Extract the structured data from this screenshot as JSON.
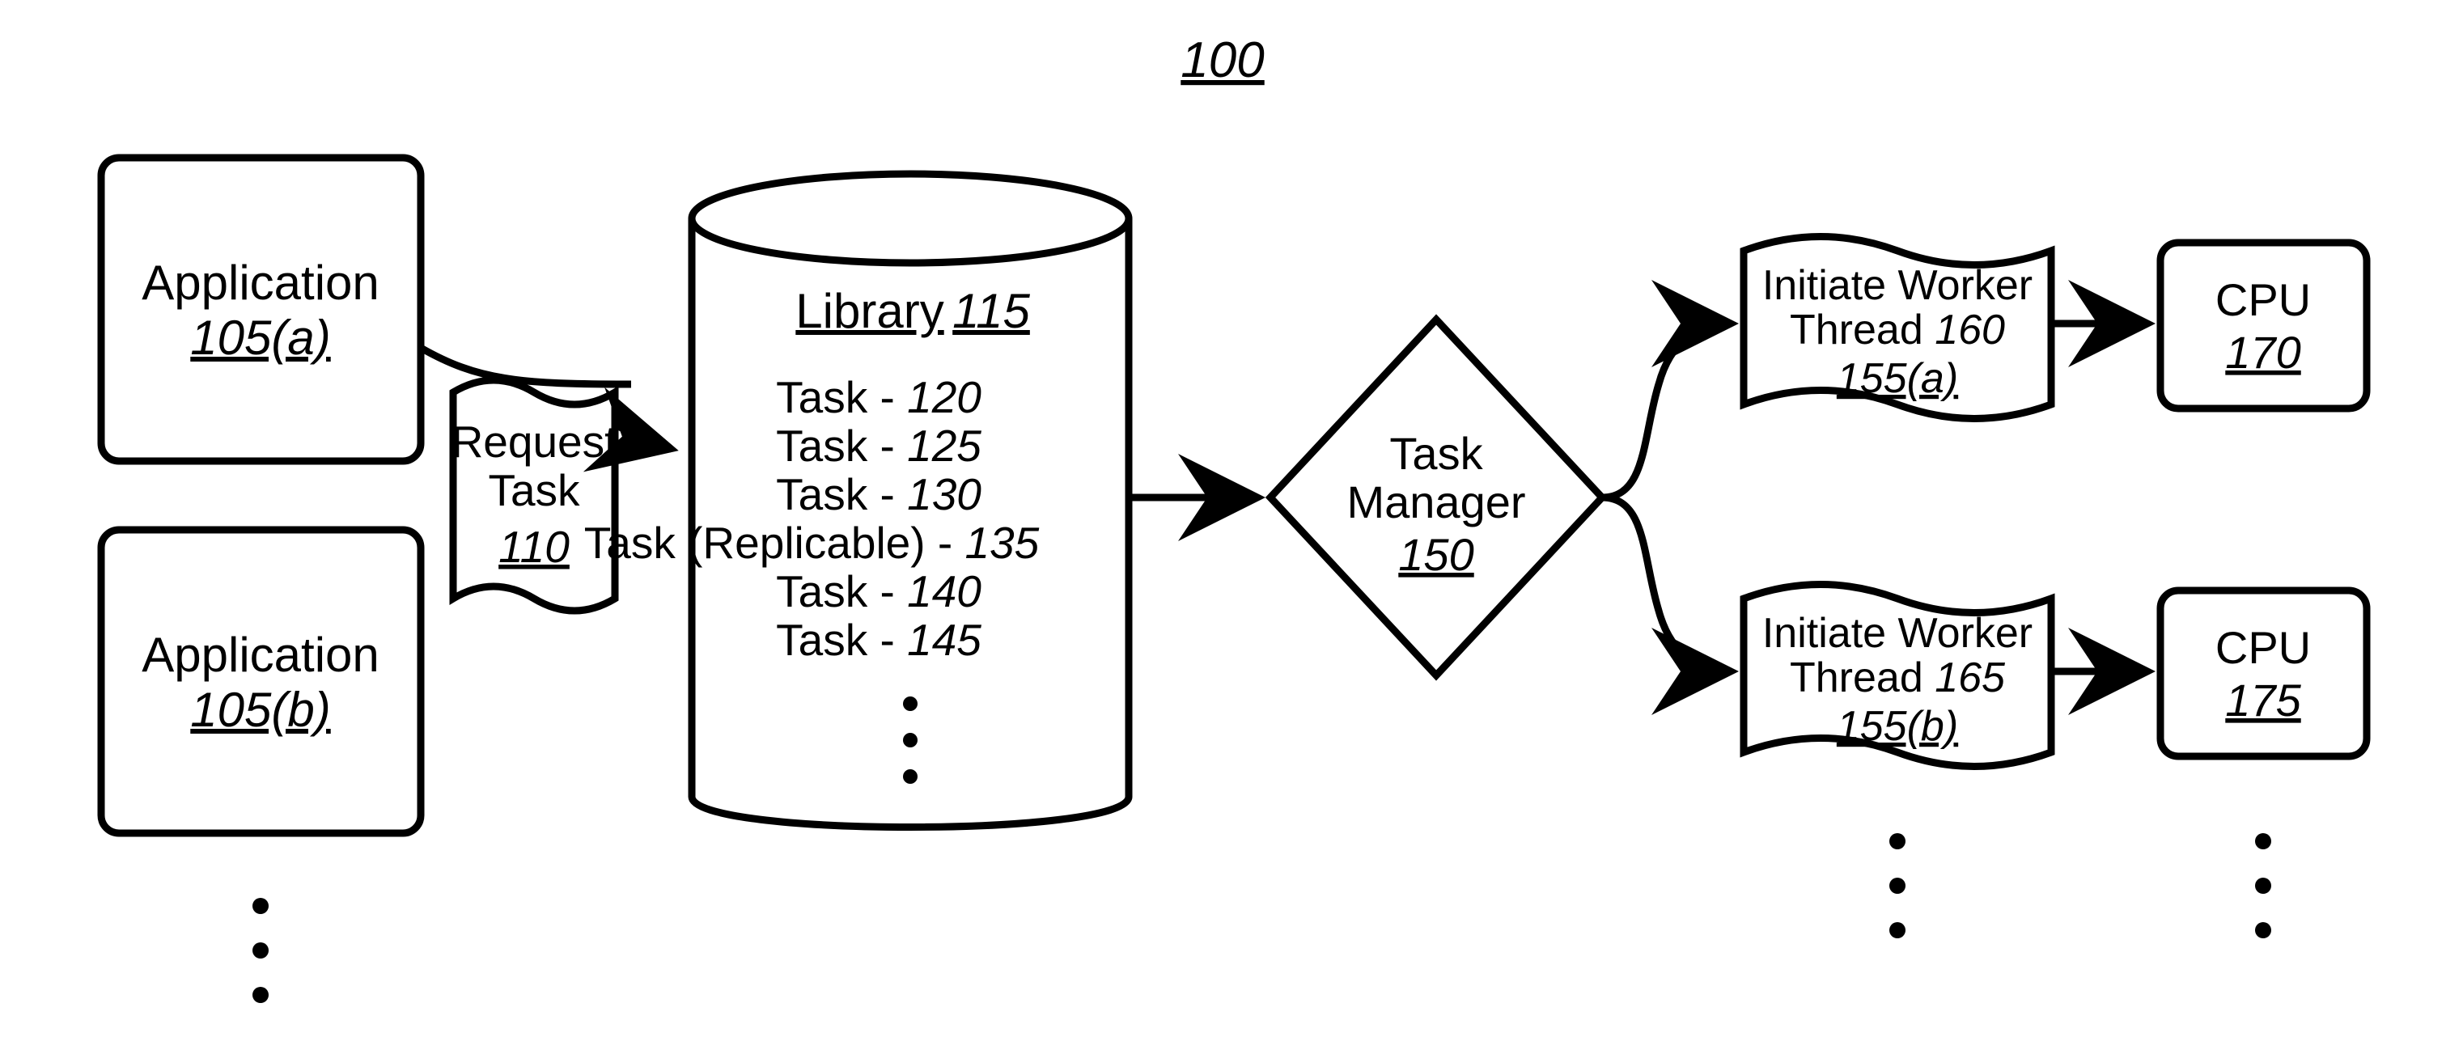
{
  "figure_ref": "100",
  "application_a": {
    "label": "Application",
    "ref": "105(a)"
  },
  "application_b": {
    "label": "Application",
    "ref": "105(b)"
  },
  "request_task": {
    "label": "Request Task",
    "ref": "110"
  },
  "library": {
    "title": "Library",
    "ref": "115",
    "tasks": [
      {
        "label": "Task",
        "ref": "120"
      },
      {
        "label": "Task",
        "ref": "125"
      },
      {
        "label": "Task",
        "ref": "130"
      },
      {
        "label": "Task (Replicable)",
        "ref": "135"
      },
      {
        "label": "Task",
        "ref": "140"
      },
      {
        "label": "Task",
        "ref": "145"
      }
    ]
  },
  "task_manager": {
    "label": "Task Manager",
    "ref": "150"
  },
  "worker_a": {
    "label1": "Initiate Worker",
    "label2": "Thread",
    "thread_ref": "160",
    "ref": "155(a)"
  },
  "worker_b": {
    "label1": "Initiate Worker",
    "label2": "Thread",
    "thread_ref": "165",
    "ref": "155(b)"
  },
  "cpu_a": {
    "label": "CPU",
    "ref": "170"
  },
  "cpu_b": {
    "label": "CPU",
    "ref": "175"
  }
}
